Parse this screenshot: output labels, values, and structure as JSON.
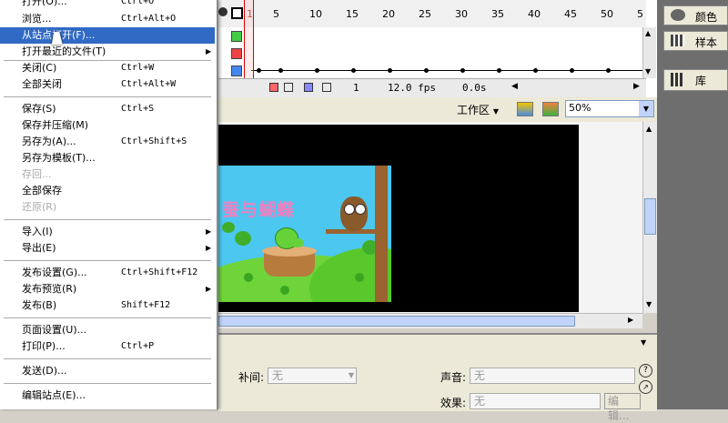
{
  "menu": {
    "items": [
      {
        "label": "打开(O)...",
        "shortcut": "Ctrl+O"
      },
      {
        "label": "浏览...",
        "shortcut": "Ctrl+Alt+O"
      },
      {
        "label": "从站点打开(F)...",
        "shortcut": ""
      },
      {
        "label": "打开最近的文件(T)",
        "shortcut": ""
      },
      {
        "label": "关闭(C)",
        "shortcut": "Ctrl+W"
      },
      {
        "label": "全部关闭",
        "shortcut": "Ctrl+Alt+W"
      },
      {
        "label": "保存(S)",
        "shortcut": "Ctrl+S"
      },
      {
        "label": "保存并压缩(M)",
        "shortcut": ""
      },
      {
        "label": "另存为(A)...",
        "shortcut": "Ctrl+Shift+S"
      },
      {
        "label": "另存为模板(T)...",
        "shortcut": ""
      },
      {
        "label": "存回...",
        "shortcut": ""
      },
      {
        "label": "全部保存",
        "shortcut": ""
      },
      {
        "label": "还原(R)",
        "shortcut": ""
      },
      {
        "label": "导入(I)",
        "shortcut": ""
      },
      {
        "label": "导出(E)",
        "shortcut": ""
      },
      {
        "label": "发布设置(G)...",
        "shortcut": "Ctrl+Shift+F12"
      },
      {
        "label": "发布预览(R)",
        "shortcut": ""
      },
      {
        "label": "发布(B)",
        "shortcut": "Shift+F12"
      },
      {
        "label": "页面设置(U)...",
        "shortcut": ""
      },
      {
        "label": "打印(P)...",
        "shortcut": "Ctrl+P"
      },
      {
        "label": "发送(D)...",
        "shortcut": ""
      },
      {
        "label": "编辑站点(E)...",
        "shortcut": ""
      }
    ]
  },
  "timeline": {
    "frame_numbers": [
      "1",
      "5",
      "10",
      "15",
      "20",
      "25",
      "30",
      "35",
      "40",
      "45",
      "50",
      "5"
    ],
    "status": {
      "current_frame": "1",
      "fps": "12.0 fps",
      "time": "0.0s"
    },
    "layer_colors": [
      "#44cc44",
      "#ee4444",
      "#4488ee"
    ]
  },
  "edit_bar": {
    "workspace_label": "工作区",
    "zoom_value": "50%"
  },
  "stage": {
    "title_text": "蚕与蝴蝶"
  },
  "properties": {
    "tween_label": "补间:",
    "tween_value": "无",
    "sound_label": "声音:",
    "sound_value": "无",
    "effect_label": "效果:",
    "effect_value": "无",
    "edit_button": "编辑..."
  },
  "right_panel": {
    "color_label": "颜色",
    "swatches_label": "样本",
    "library_label": "库"
  }
}
